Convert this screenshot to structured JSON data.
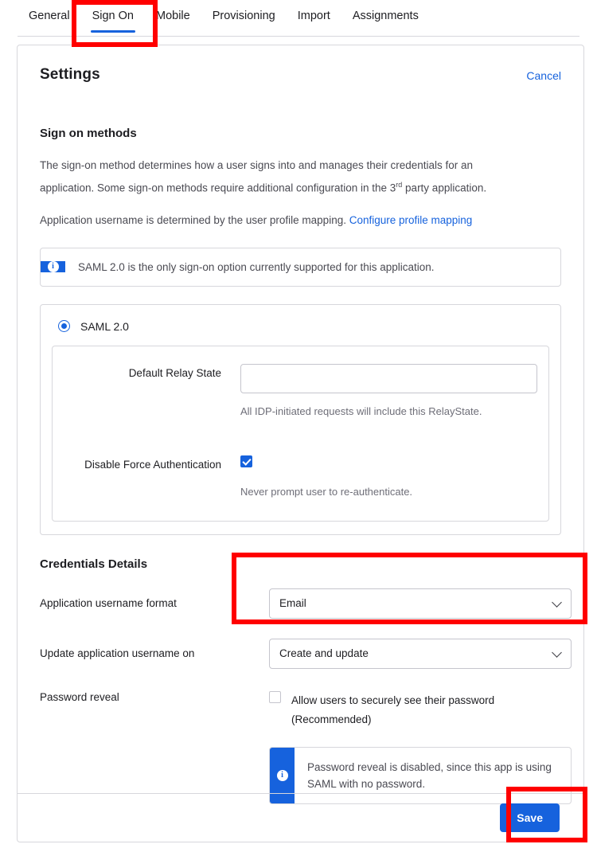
{
  "tabs": [
    {
      "label": "General",
      "active": false
    },
    {
      "label": "Sign On",
      "active": true
    },
    {
      "label": "Mobile",
      "active": false
    },
    {
      "label": "Provisioning",
      "active": false
    },
    {
      "label": "Import",
      "active": false
    },
    {
      "label": "Assignments",
      "active": false
    }
  ],
  "card": {
    "title": "Settings",
    "cancel_label": "Cancel"
  },
  "sign_on": {
    "section_title": "Sign on methods",
    "paragraph_1_part_a": "The sign-on method determines how a user signs into and manages their credentials for an application. Some sign-on methods require additional configuration in the 3",
    "paragraph_1_sup": "rd",
    "paragraph_1_part_b": " party application.",
    "paragraph_2_text": "Application username is determined by the user profile mapping. ",
    "paragraph_2_link": "Configure profile mapping",
    "info_banner": {
      "icon": "info-icon",
      "message": "SAML 2.0 is the only sign-on option currently supported for this application."
    },
    "method": {
      "radio_label": "SAML 2.0",
      "radio_selected": true,
      "fields": [
        {
          "label": "Default Relay State",
          "type": "text",
          "value": "",
          "placeholder": "",
          "hint": "All IDP-initiated requests will include this RelayState."
        },
        {
          "label": "Disable Force Authentication",
          "type": "checkbox",
          "checked": true,
          "hint": "Never prompt user to re-authenticate."
        }
      ]
    }
  },
  "credentials": {
    "section_title": "Credentials Details",
    "username_format": {
      "label": "Application username format",
      "value": "Email",
      "chevron": "chevron-down-icon"
    },
    "update_username_on": {
      "label": "Update application username on",
      "value": "Create and update",
      "chevron": "chevron-down-icon"
    },
    "password_reveal": {
      "label": "Password reveal",
      "checkbox_label": "Allow users to securely see their password (Recommended)",
      "checked": false,
      "info_banner": {
        "icon": "info-icon",
        "message": "Password reveal is disabled, since this app is using SAML with no password."
      }
    }
  },
  "footer": {
    "save_label": "Save"
  },
  "colors": {
    "accent": "#1662dd",
    "highlight": "#ff0000",
    "text": "#1d1d21",
    "muted": "#6e6e78",
    "border": "#d7d7dc"
  },
  "glyphs": {
    "info": "i"
  }
}
